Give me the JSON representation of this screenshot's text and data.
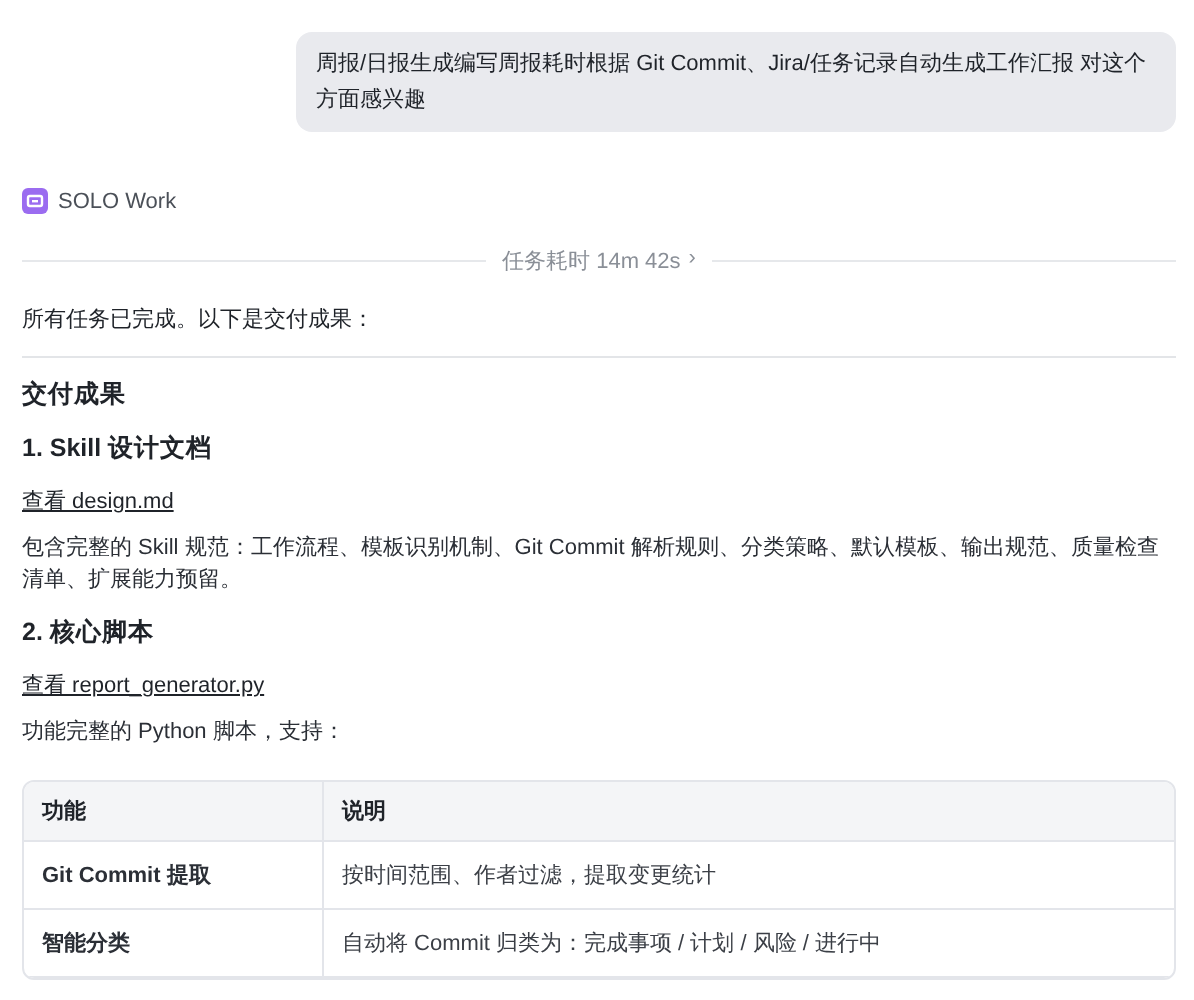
{
  "user_message": "周报/日报生成编写周报耗时根据 Git Commit、Jira/任务记录自动生成工作汇报 对这个方面感兴趣",
  "agent": {
    "name": "SOLO Work"
  },
  "duration": {
    "label": "任务耗时 14m 42s",
    "chevron": "›"
  },
  "summary": "所有任务已完成。以下是交付成果：",
  "heading": "交付成果",
  "sections": [
    {
      "title": "1. Skill 设计文档",
      "link": "查看 design.md",
      "text": "包含完整的 Skill 规范：工作流程、模板识别机制、Git Commit 解析规则、分类策略、默认模板、输出规范、质量检查清单、扩展能力预留。"
    },
    {
      "title": "2. 核心脚本",
      "link": "查看 report_generator.py",
      "text": "功能完整的 Python 脚本，支持："
    }
  ],
  "table": {
    "columns": [
      "功能",
      "说明"
    ],
    "rows": [
      [
        "Git Commit 提取",
        "按时间范围、作者过滤，提取变更统计"
      ],
      [
        "智能分类",
        "自动将 Commit 归类为：完成事项 / 计划 / 风险 / 进行中"
      ]
    ]
  }
}
